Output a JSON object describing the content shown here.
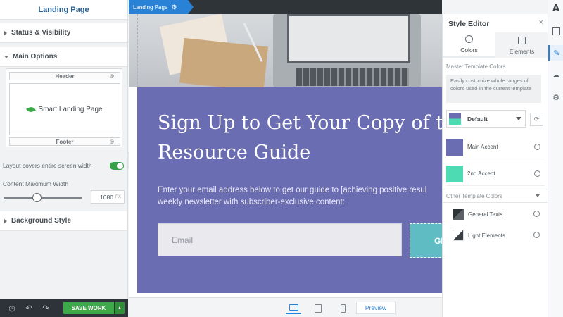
{
  "left_panel": {
    "title": "Landing Page",
    "sections": {
      "status_visibility": "Status & Visibility",
      "main_options": "Main Options",
      "background_style": "Background Style"
    },
    "layout_preview": {
      "header": "Header",
      "body": "Smart Landing Page",
      "footer": "Footer"
    },
    "layout_covers_label": "Layout covers entire screen width",
    "layout_covers_enabled": true,
    "content_max_width_label": "Content Maximum Width",
    "content_max_width_value": "1080",
    "content_max_width_unit": "PX",
    "save_button": "SAVE WORK"
  },
  "canvas": {
    "page_tab": "Landing Page",
    "headline_line1": "Sign Up to Get Your Copy of the",
    "headline_line2": "Resource Guide",
    "subtext_line1": "Enter your email address below to get our guide to [achieving positive resul",
    "subtext_line2": "weekly newsletter with subscriber-exclusive content:",
    "email_placeholder": "Email",
    "cta_label": "GE",
    "colors": {
      "purple": "#6b6db3",
      "teal": "#5fbcc3",
      "tab_blue": "#2a82d6"
    }
  },
  "device_bar": {
    "devices": [
      "desktop",
      "tablet",
      "phone"
    ],
    "active_device": "desktop",
    "preview_label": "Preview"
  },
  "style_editor": {
    "title": "Style Editor",
    "tabs": [
      "Colors",
      "Elements"
    ],
    "active_tab": "Colors",
    "master_label": "Master Template Colors",
    "info_text": "Easily customize whole ranges of colors used in the current template",
    "preset": "Default",
    "master_colors": [
      {
        "label": "Main Accent",
        "color": "#6b6db3"
      },
      {
        "label": "2nd Accent",
        "color": "#4ddbb4"
      }
    ],
    "other_label": "Other Template Colors",
    "other_colors": [
      {
        "label": "General Texts",
        "icon": "dark-diagonal-swatch"
      },
      {
        "label": "Light Elements",
        "icon": "light-diagonal-swatch"
      }
    ]
  },
  "right_rail": {
    "icons": [
      "logo-icon",
      "add-icon",
      "brush-icon",
      "cloud-icon",
      "gear-icon"
    ],
    "logo_glyph": "A"
  }
}
